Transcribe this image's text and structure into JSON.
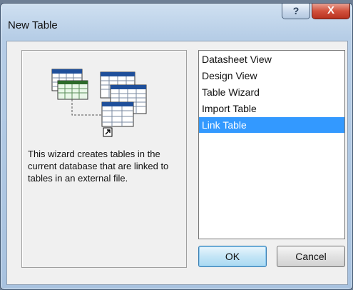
{
  "window": {
    "title": "New Table",
    "help_glyph": "?",
    "close_glyph": "X"
  },
  "info": {
    "description": "This wizard creates tables in the current database that are linked to tables in an external file."
  },
  "options": [
    {
      "label": "Datasheet View",
      "selected": false
    },
    {
      "label": "Design View",
      "selected": false
    },
    {
      "label": "Table Wizard",
      "selected": false
    },
    {
      "label": "Import Table",
      "selected": false
    },
    {
      "label": "Link Table",
      "selected": true
    }
  ],
  "buttons": {
    "ok": "OK",
    "cancel": "Cancel"
  },
  "colors": {
    "selection": "#3399ff",
    "close_button": "#c8412f"
  }
}
